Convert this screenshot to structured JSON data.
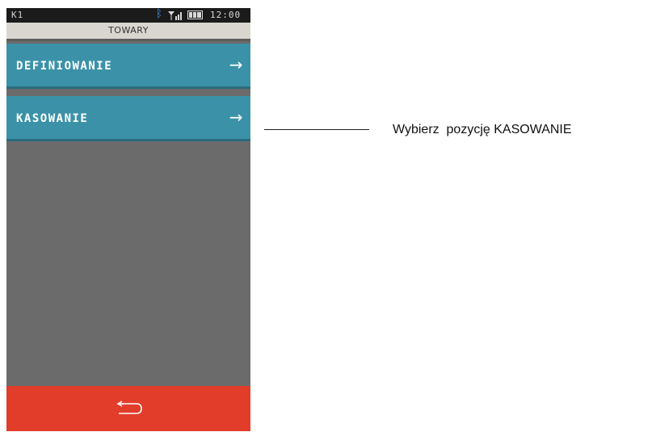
{
  "statusbar": {
    "cashier": "K1",
    "time": "12:00",
    "bluetooth_icon": "bluetooth-icon",
    "signal_icon": "signal-icon",
    "battery_icon": "battery-icon"
  },
  "title": "TOWARY",
  "menu": [
    {
      "label": "DEFINIOWANIE",
      "icon": "arrow-right-icon"
    },
    {
      "label": "KASOWANIE",
      "icon": "arrow-right-icon"
    }
  ],
  "bottom": {
    "icon": "back-icon"
  },
  "callout": {
    "text": "Wybierz  pozycję KASOWANIE"
  },
  "colors": {
    "menu": "#3b92a8",
    "bottom": "#e23d2a",
    "title": "#d8d6cf",
    "background": "#6b6b6b"
  }
}
